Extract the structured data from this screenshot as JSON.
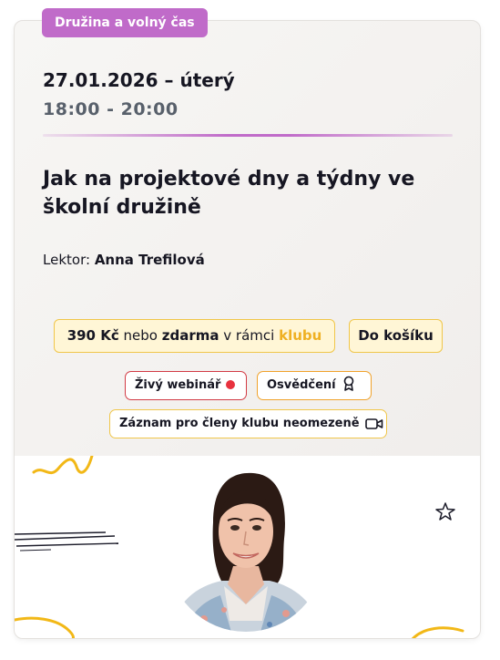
{
  "event": {
    "category": "Družina a volný čas",
    "date": "27.01.2026 – úterý",
    "time": "18:00 - 20:00",
    "title": "Jak na projektové dny a týdny ve školní družině",
    "lecturer_label": "Lektor:",
    "lecturer_name": "Anna Trefilová"
  },
  "pricing": {
    "price": "390 Kč",
    "or": "nebo",
    "free": "zdarma",
    "within": "v rámci",
    "club": "klubu",
    "cart_button": "Do košíku"
  },
  "features": {
    "live": "Živý webinář",
    "certificate": "Osvědčení",
    "recording": "Záznam pro členy klubu neomezeně"
  },
  "icons": {
    "live": "red-dot-icon",
    "certificate": "award-ribbon-icon",
    "recording": "video-camera-icon"
  },
  "colors": {
    "category": "#c06bc9",
    "accent_yellow": "#f0c64a",
    "live_red": "#e8323e"
  }
}
